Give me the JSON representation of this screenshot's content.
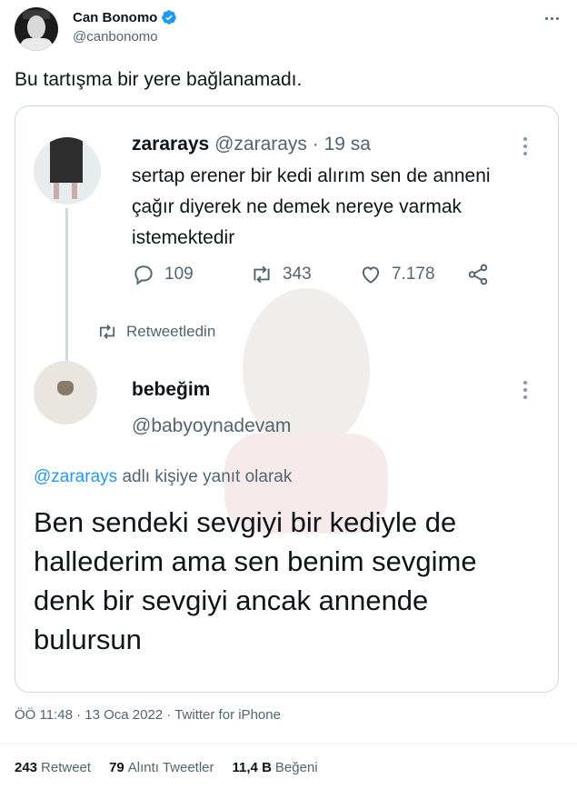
{
  "author": {
    "display_name": "Can Bonomo",
    "handle": "@canbonomo"
  },
  "tweet_text": "Bu tartışma bir yere bağlanamadı.",
  "embedded": {
    "first_tweet": {
      "name": "zararays",
      "handle": "@zararays",
      "time": "· 19 sa",
      "text": "sertap erener bir kedi alırım sen de anneni çağır diyerek ne demek nereye varmak istemektedir",
      "replies": "109",
      "retweets": "343",
      "likes": "7.178"
    },
    "retweeted_label": "Retweetledin",
    "second_tweet": {
      "name": "bebeğim",
      "handle": "@babyoynadevam",
      "reply_mention": "@zararays",
      "reply_suffix": "adlı kişiye yanıt olarak",
      "text": "Ben sendeki sevgiyi bir kediyle de hallederim ama sen benim sevgime denk bir sevgiyi ancak annende bulursun"
    }
  },
  "meta": "ÖÖ 11:48 · 13 Oca 2022 · Twitter for iPhone",
  "stats": {
    "retweet_count": "243",
    "retweet_label": "Retweet",
    "quote_count": "79",
    "quote_label": "Alıntı Tweetler",
    "like_count": "11,4 B",
    "like_label": "Beğeni"
  },
  "colors": {
    "link": "#1d9bf0",
    "secondary_text": "#536471",
    "verified": "#1d9bf0"
  }
}
